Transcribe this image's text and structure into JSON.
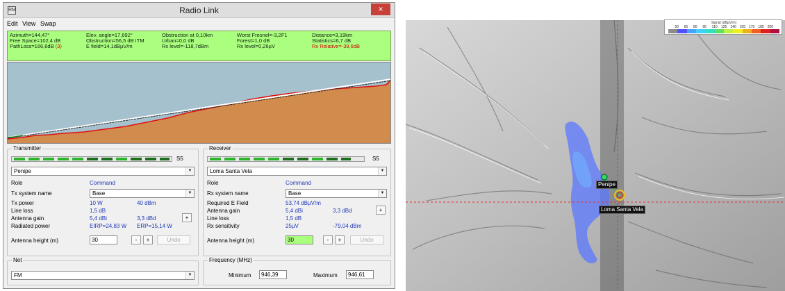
{
  "window": {
    "app_icon": "radio-mobile-icon",
    "title": "Radio Link",
    "close_label": "×"
  },
  "menu": [
    "Edit",
    "View",
    "Swap"
  ],
  "stats": {
    "col1": [
      "Azimuth=144,47°",
      "Free Space=102,4 dB",
      "PathLoss=166,6dB"
    ],
    "pathloss_suffix": "(3)",
    "col2": [
      "Elev. angle=17,692°",
      "Obstruction=56,5 dB ITM",
      "E field=14,1dBµV/m"
    ],
    "col3": [
      "Obstruction at 0,10km",
      "Urban=0,0 dB",
      "Rx level=-118,7dBm"
    ],
    "col4": [
      "Worst Fresnel=-3,2F1",
      "Forest=1,0 dB",
      "Rx level=0,26µV"
    ],
    "col5": [
      "Distance=3,19km",
      "Statistics=6,7 dB",
      "Rx Relative=-39,6dB"
    ]
  },
  "colors": {
    "stats_bg": "#aaff7e",
    "sky": "#a5c1ce",
    "terrain": "#d18b4d",
    "obstruction_line": "#e01010",
    "meter_green": "#2bb52b",
    "meter_dark": "#1c6e1c",
    "rx_relative": "#d40000",
    "value_blue": "#1f39b8"
  },
  "transmitter": {
    "label": "Transmitter",
    "meter_label": "S5",
    "unit_name": "Penipe",
    "role_label": "Role",
    "role_value": "Command",
    "system_label": "Tx system name",
    "system_value": "Base",
    "power_label": "Tx power",
    "power_w": "10 W",
    "power_dbm": "40 dBm",
    "loss_label": "Line loss",
    "loss_value": "1,5 dB",
    "gain_label": "Antenna gain",
    "gain_dbi": "5,4 dBi",
    "gain_dbd": "3,3 dBd",
    "radiated_label": "Radiated power",
    "eirp": "EIRP=24,83 W",
    "erp": "ERP=15,14 W",
    "height_label": "Antenna height (m)",
    "height_value": "30",
    "minus": "-",
    "plus": "+",
    "undo": "Undo"
  },
  "receiver": {
    "label": "Receiver",
    "meter_label": "S5",
    "unit_name": "Loma Santa Vela",
    "role_label": "Role",
    "role_value": "Command",
    "system_label": "Rx system name",
    "system_value": "Base",
    "field_label": "Required E Field",
    "field_value": "53,74 dBµV/m",
    "gain_label": "Antenna gain",
    "gain_dbi": "5,4 dBi",
    "gain_dbd": "3,3 dBd",
    "loss_label": "Line loss",
    "loss_value": "1,5 dB",
    "sens_label": "Rx sensitivity",
    "sens_uv": "25µV",
    "sens_dbm": "-79,04 dBm",
    "height_label": "Antenna height (m)",
    "height_value": "30",
    "minus": "-",
    "plus": "+",
    "undo": "Undo"
  },
  "net": {
    "label": "Net",
    "value": "FM"
  },
  "frequency": {
    "label": "Frequency (MHz)",
    "min_label": "Minimum",
    "min_value": "946,39",
    "max_label": "Maximum",
    "max_value": "946,61"
  },
  "map": {
    "legend_title": "Signal (dBµV/m)",
    "legend_ticks": [
      "50",
      "65",
      "80",
      "95",
      "110",
      "125",
      "140",
      "155",
      "170",
      "185",
      "200"
    ],
    "legend_colors": [
      "#8c8c8c",
      "#5050ff",
      "#4aa0ff",
      "#40d0ff",
      "#30e0c0",
      "#60e060",
      "#c0f040",
      "#f0f020",
      "#f0b020",
      "#f06020",
      "#e02020",
      "#b01040"
    ],
    "tx_site": "Penipe",
    "rx_site": "Loma Santa Vela"
  }
}
